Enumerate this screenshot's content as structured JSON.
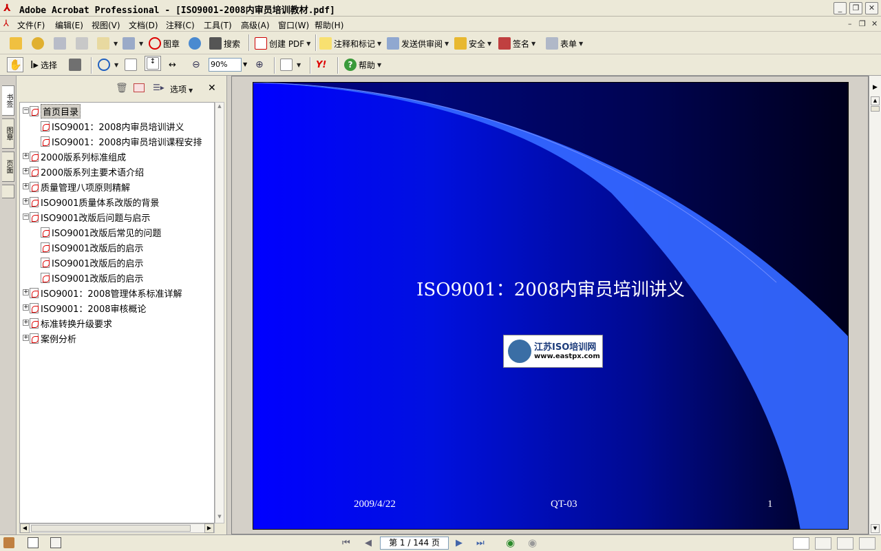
{
  "window": {
    "title": "Adobe Acrobat Professional - [ISO9001-2008内审员培训教材.pdf]"
  },
  "menu": [
    "文件(F)",
    "编辑(E)",
    "视图(V)",
    "文档(D)",
    "注释(C)",
    "工具(T)",
    "高级(A)",
    "窗口(W)",
    "帮助(H)"
  ],
  "toolbar1": {
    "stamp": "图章",
    "search": "搜索",
    "create_pdf": "创建 PDF",
    "comment": "注释和标记",
    "send_review": "发送供审阅",
    "secure": "安全",
    "sign": "签名",
    "forms": "表单"
  },
  "toolbar2": {
    "select": "选择",
    "zoom": "90%",
    "help": "帮助"
  },
  "side_tabs": [
    "书签",
    "图章",
    "页面"
  ],
  "nav": {
    "options": "选项"
  },
  "bookmarks": [
    {
      "label": "首页目录",
      "level": 0,
      "expander": "−",
      "selected": true,
      "type": "folder"
    },
    {
      "label": "ISO9001：2008内审员培训讲义",
      "level": 1
    },
    {
      "label": "ISO9001：2008内审员培训课程安排",
      "level": 1
    },
    {
      "label": "2000版系列标准组成",
      "level": 0,
      "expander": "+"
    },
    {
      "label": "2000版系列主要术语介绍",
      "level": 0,
      "expander": "+"
    },
    {
      "label": "质量管理八项原则精解",
      "level": 0,
      "expander": "+"
    },
    {
      "label": "ISO9001质量体系改版的背景",
      "level": 0,
      "expander": "+"
    },
    {
      "label": "ISO9001改版后问题与启示",
      "level": 0,
      "expander": "−"
    },
    {
      "label": "ISO9001改版后常见的问题",
      "level": 1
    },
    {
      "label": "ISO9001改版后的启示",
      "level": 1
    },
    {
      "label": "ISO9001改版后的启示",
      "level": 1
    },
    {
      "label": "ISO9001改版后的启示",
      "level": 1
    },
    {
      "label": "ISO9001：2008管理体系标准详解",
      "level": 0,
      "expander": "+"
    },
    {
      "label": "ISO9001：2008审核概论",
      "level": 0,
      "expander": "+"
    },
    {
      "label": "标准转换升级要求",
      "level": 0,
      "expander": "+"
    },
    {
      "label": "案例分析",
      "level": 0,
      "expander": "+"
    }
  ],
  "slide": {
    "title": "ISO9001：2008内审员培训讲义",
    "logo_cn": "江苏ISO培训网",
    "logo_url": "www.eastpx.com",
    "date": "2009/4/22",
    "code": "QT-03",
    "page": "1"
  },
  "status": {
    "page_display": "第 1 / 144 页"
  }
}
